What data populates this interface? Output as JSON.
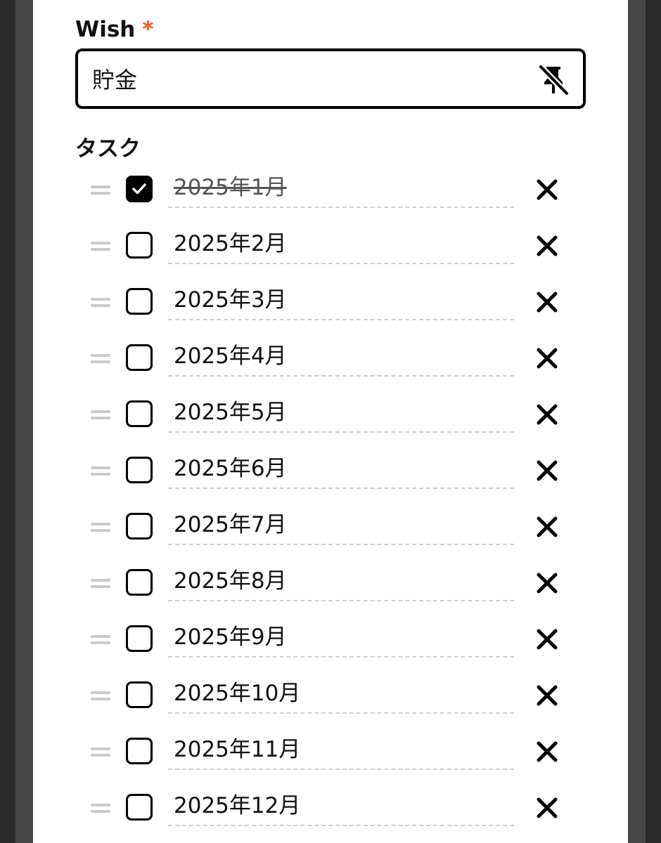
{
  "colors": {
    "accent_required": "#f2561d",
    "border": "#000000",
    "handle": "#c9c9c9",
    "divider": "#cfcfcf"
  },
  "wish": {
    "label": "Wish",
    "required_mark": "*",
    "value": "貯金",
    "unpin_icon": "pin-off-icon"
  },
  "tasks": {
    "heading": "タスク",
    "handle_icon": "drag-handle-icon",
    "delete_icon": "close-icon",
    "items": [
      {
        "label": "2025年1月",
        "checked": true
      },
      {
        "label": "2025年2月",
        "checked": false
      },
      {
        "label": "2025年3月",
        "checked": false
      },
      {
        "label": "2025年4月",
        "checked": false
      },
      {
        "label": "2025年5月",
        "checked": false
      },
      {
        "label": "2025年6月",
        "checked": false
      },
      {
        "label": "2025年7月",
        "checked": false
      },
      {
        "label": "2025年8月",
        "checked": false
      },
      {
        "label": "2025年9月",
        "checked": false
      },
      {
        "label": "2025年10月",
        "checked": false
      },
      {
        "label": "2025年11月",
        "checked": false
      },
      {
        "label": "2025年12月",
        "checked": false
      }
    ]
  }
}
